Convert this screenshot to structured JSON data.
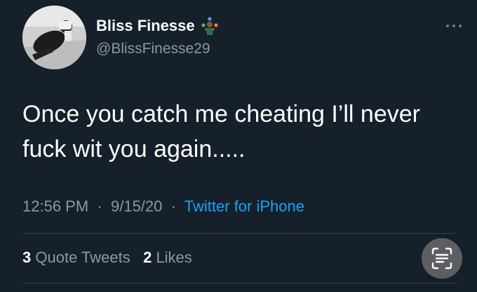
{
  "user": {
    "display_name": "Bliss Finesse",
    "handle": "@BlissFinesse29"
  },
  "tweet": {
    "text": "Once you catch me cheating I’ll never fuck wit you again.....",
    "time": "12:56 PM",
    "date": "9/15/20",
    "source": "Twitter for iPhone"
  },
  "stats": {
    "quote_tweets_count": "3",
    "quote_tweets_label": "Quote Tweets",
    "likes_count": "2",
    "likes_label": "Likes"
  },
  "icons": {
    "name_badge": "juggler-emoji-icon",
    "more": "more-options-icon",
    "scan": "live-text-scan-icon"
  },
  "colors": {
    "background": "#15202b",
    "secondary_text": "#8899a6",
    "link": "#1da1f2",
    "divider": "#2f3d4a"
  }
}
